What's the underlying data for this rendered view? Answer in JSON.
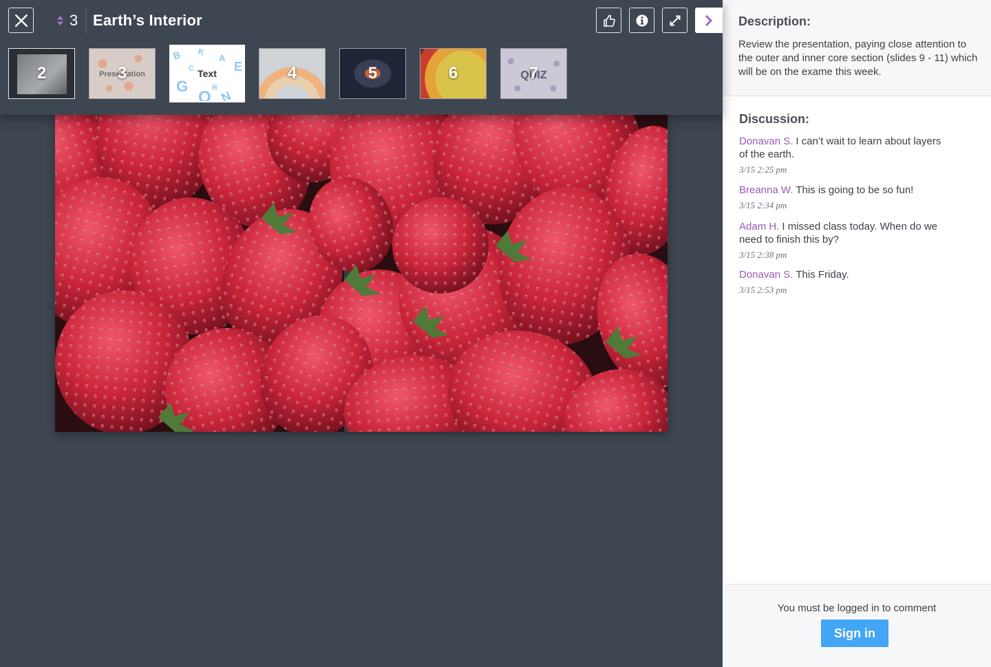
{
  "header": {
    "slide_number": "3",
    "title": "Earth’s Interior",
    "icons": {
      "close": "close-icon",
      "sort": "sort-arrows-icon",
      "like": "thumbs-up-icon",
      "info": "info-icon",
      "expand": "expand-icon",
      "panel_toggle": "chevron-right-icon"
    }
  },
  "thumbnails": [
    {
      "label": "2"
    },
    {
      "label": "3",
      "sub": "Presentation"
    },
    {
      "label": "Text",
      "active": true
    },
    {
      "label": "4"
    },
    {
      "label": "5"
    },
    {
      "label": "6"
    },
    {
      "label": "7",
      "sub": "QUIZ"
    }
  ],
  "description": {
    "heading": "Description:",
    "text": "Review the presentation, paying close attention to the outer and inner core section (slides 9 - 11) which will be on the exame this week."
  },
  "discussion": {
    "heading": "Discussion:",
    "comments": [
      {
        "author": "Donavan S.",
        "text": "I can’t wait to learn about layers of the earth.",
        "time": "3/15 2:25 pm"
      },
      {
        "author": "Breanna W.",
        "text": "This is going to be so fun!",
        "time": "3/15 2:34 pm"
      },
      {
        "author": "Adam H.",
        "text": "I missed class today. When do we need to finish this by?",
        "time": "3/15 2:38 pm"
      },
      {
        "author": "Donavan S.",
        "text": "This Friday.",
        "time": "3/15 2:53 pm"
      }
    ]
  },
  "footer": {
    "login_message": "You must be logged in to comment",
    "signin_label": "Sign in"
  },
  "colors": {
    "background": "#3e4651",
    "accent_purple": "#9b59b6",
    "signin_blue": "#42a5f5"
  }
}
